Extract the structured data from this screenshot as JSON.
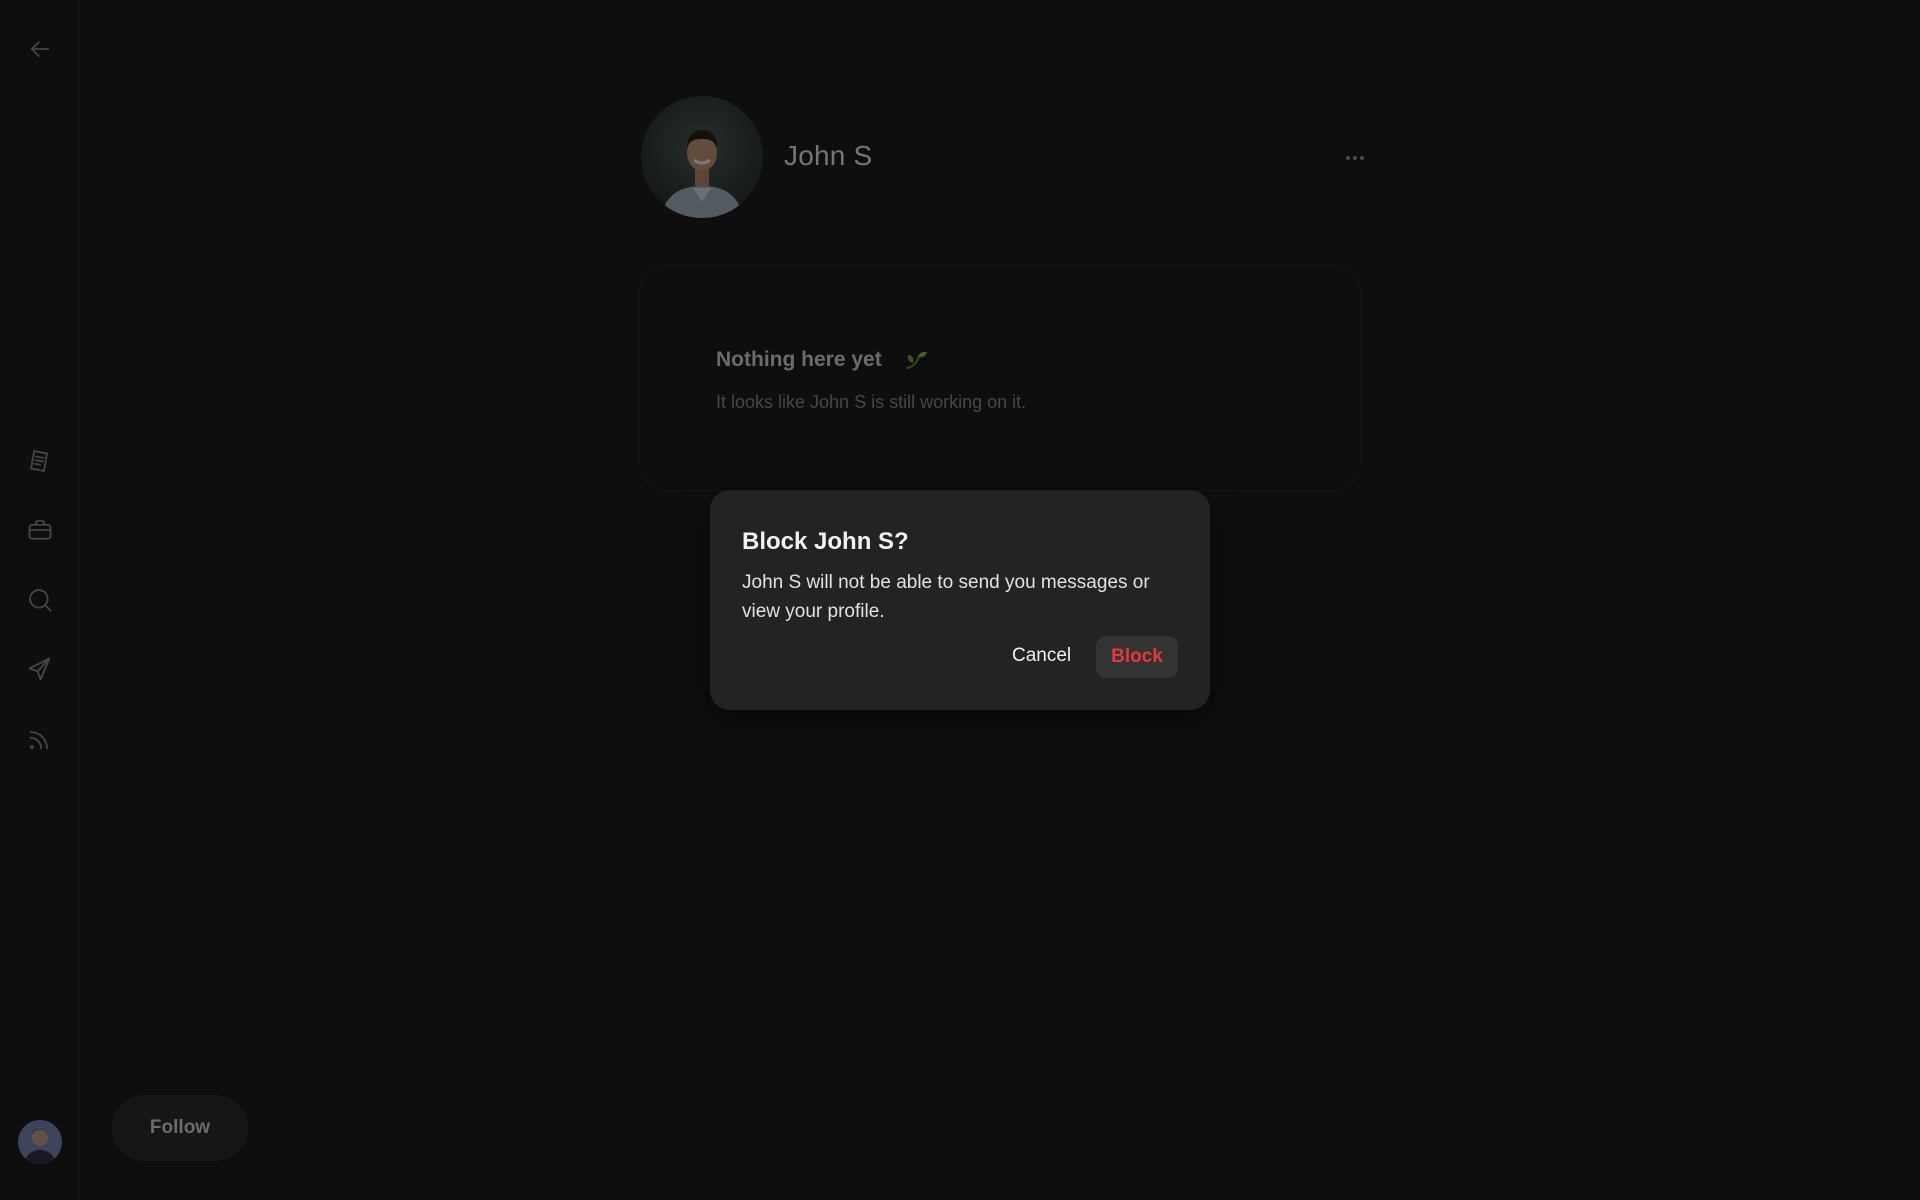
{
  "sidebar": {
    "back_icon": "arrow-left-icon",
    "items": [
      {
        "name": "notes",
        "icon": "document-icon"
      },
      {
        "name": "jobs",
        "icon": "briefcase-icon"
      },
      {
        "name": "search",
        "icon": "search-icon"
      },
      {
        "name": "messages",
        "icon": "send-icon"
      },
      {
        "name": "feed",
        "icon": "rss-icon"
      }
    ],
    "user_avatar": "user-avatar"
  },
  "profile": {
    "name": "John S",
    "avatar": "profile-photo",
    "more_icon": "more-horizontal-icon"
  },
  "empty_state": {
    "title": "Nothing here yet",
    "title_icon": "seedling-icon",
    "subtitle": "It looks like John S is still working on it."
  },
  "follow_button": {
    "label": "Follow"
  },
  "dialog": {
    "title": "Block John S?",
    "body": "John S will not be able to send you messages or view your profile.",
    "cancel_label": "Cancel",
    "confirm_label": "Block"
  },
  "colors": {
    "background": "#1c1c1c",
    "dialog": "#232323",
    "danger": "#e5383b",
    "button": "#333333"
  }
}
